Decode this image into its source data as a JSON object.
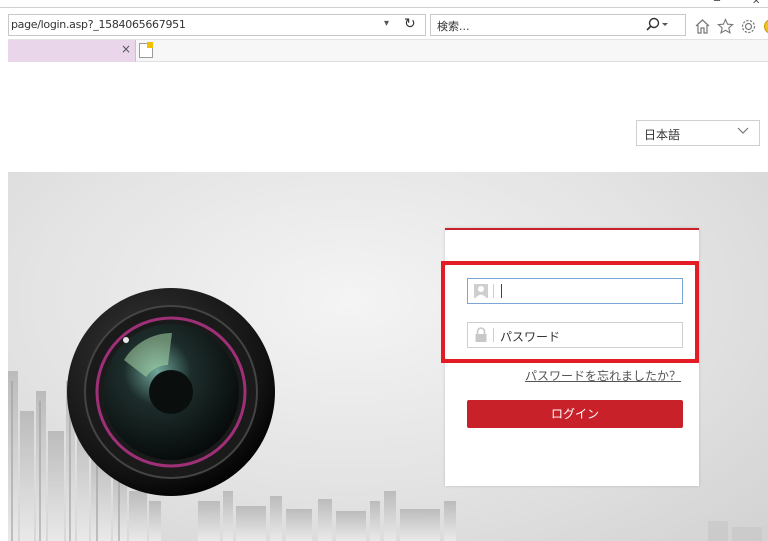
{
  "browser": {
    "address": "page/login.asp?_1584065667951",
    "address_dropdown": "▾",
    "refresh_icon": "refresh-icon",
    "search_placeholder": "検索...",
    "search_suffix": "▾",
    "toolbar_icons": [
      "home-icon",
      "favorites-star-icon",
      "settings-gear-icon",
      "smiley-feedback-icon"
    ],
    "tab_close": "×"
  },
  "header": {
    "language_selected": "日本語"
  },
  "login": {
    "username_value": "",
    "password_placeholder": "パスワード",
    "forgot_link": "パスワードを忘れましたか？",
    "login_button": "ログイン"
  },
  "colors": {
    "accent": "#c9212a",
    "highlight": "#e21b24"
  }
}
